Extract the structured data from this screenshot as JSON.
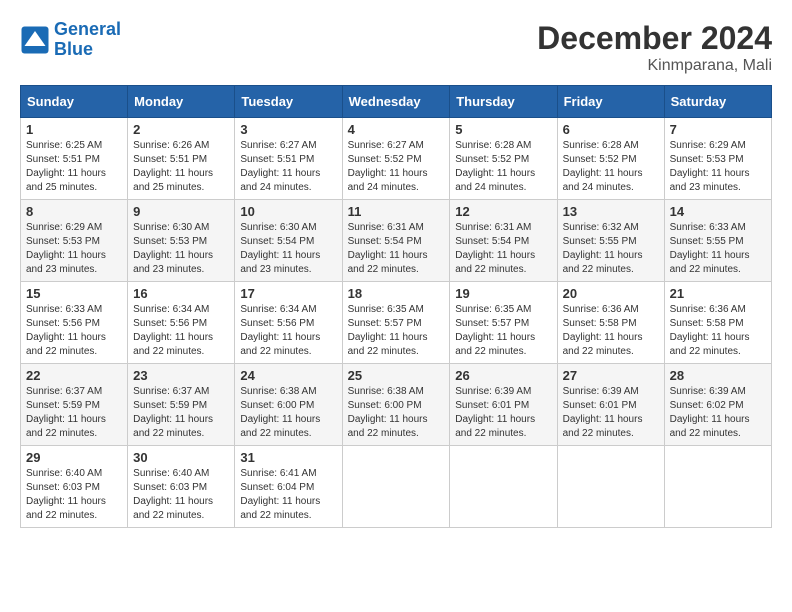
{
  "header": {
    "logo_line1": "General",
    "logo_line2": "Blue",
    "month": "December 2024",
    "location": "Kinmparana, Mali"
  },
  "weekdays": [
    "Sunday",
    "Monday",
    "Tuesday",
    "Wednesday",
    "Thursday",
    "Friday",
    "Saturday"
  ],
  "weeks": [
    [
      {
        "day": "1",
        "info": "Sunrise: 6:25 AM\nSunset: 5:51 PM\nDaylight: 11 hours\nand 25 minutes."
      },
      {
        "day": "2",
        "info": "Sunrise: 6:26 AM\nSunset: 5:51 PM\nDaylight: 11 hours\nand 25 minutes."
      },
      {
        "day": "3",
        "info": "Sunrise: 6:27 AM\nSunset: 5:51 PM\nDaylight: 11 hours\nand 24 minutes."
      },
      {
        "day": "4",
        "info": "Sunrise: 6:27 AM\nSunset: 5:52 PM\nDaylight: 11 hours\nand 24 minutes."
      },
      {
        "day": "5",
        "info": "Sunrise: 6:28 AM\nSunset: 5:52 PM\nDaylight: 11 hours\nand 24 minutes."
      },
      {
        "day": "6",
        "info": "Sunrise: 6:28 AM\nSunset: 5:52 PM\nDaylight: 11 hours\nand 24 minutes."
      },
      {
        "day": "7",
        "info": "Sunrise: 6:29 AM\nSunset: 5:53 PM\nDaylight: 11 hours\nand 23 minutes."
      }
    ],
    [
      {
        "day": "8",
        "info": "Sunrise: 6:29 AM\nSunset: 5:53 PM\nDaylight: 11 hours\nand 23 minutes."
      },
      {
        "day": "9",
        "info": "Sunrise: 6:30 AM\nSunset: 5:53 PM\nDaylight: 11 hours\nand 23 minutes."
      },
      {
        "day": "10",
        "info": "Sunrise: 6:30 AM\nSunset: 5:54 PM\nDaylight: 11 hours\nand 23 minutes."
      },
      {
        "day": "11",
        "info": "Sunrise: 6:31 AM\nSunset: 5:54 PM\nDaylight: 11 hours\nand 22 minutes."
      },
      {
        "day": "12",
        "info": "Sunrise: 6:31 AM\nSunset: 5:54 PM\nDaylight: 11 hours\nand 22 minutes."
      },
      {
        "day": "13",
        "info": "Sunrise: 6:32 AM\nSunset: 5:55 PM\nDaylight: 11 hours\nand 22 minutes."
      },
      {
        "day": "14",
        "info": "Sunrise: 6:33 AM\nSunset: 5:55 PM\nDaylight: 11 hours\nand 22 minutes."
      }
    ],
    [
      {
        "day": "15",
        "info": "Sunrise: 6:33 AM\nSunset: 5:56 PM\nDaylight: 11 hours\nand 22 minutes."
      },
      {
        "day": "16",
        "info": "Sunrise: 6:34 AM\nSunset: 5:56 PM\nDaylight: 11 hours\nand 22 minutes."
      },
      {
        "day": "17",
        "info": "Sunrise: 6:34 AM\nSunset: 5:56 PM\nDaylight: 11 hours\nand 22 minutes."
      },
      {
        "day": "18",
        "info": "Sunrise: 6:35 AM\nSunset: 5:57 PM\nDaylight: 11 hours\nand 22 minutes."
      },
      {
        "day": "19",
        "info": "Sunrise: 6:35 AM\nSunset: 5:57 PM\nDaylight: 11 hours\nand 22 minutes."
      },
      {
        "day": "20",
        "info": "Sunrise: 6:36 AM\nSunset: 5:58 PM\nDaylight: 11 hours\nand 22 minutes."
      },
      {
        "day": "21",
        "info": "Sunrise: 6:36 AM\nSunset: 5:58 PM\nDaylight: 11 hours\nand 22 minutes."
      }
    ],
    [
      {
        "day": "22",
        "info": "Sunrise: 6:37 AM\nSunset: 5:59 PM\nDaylight: 11 hours\nand 22 minutes."
      },
      {
        "day": "23",
        "info": "Sunrise: 6:37 AM\nSunset: 5:59 PM\nDaylight: 11 hours\nand 22 minutes."
      },
      {
        "day": "24",
        "info": "Sunrise: 6:38 AM\nSunset: 6:00 PM\nDaylight: 11 hours\nand 22 minutes."
      },
      {
        "day": "25",
        "info": "Sunrise: 6:38 AM\nSunset: 6:00 PM\nDaylight: 11 hours\nand 22 minutes."
      },
      {
        "day": "26",
        "info": "Sunrise: 6:39 AM\nSunset: 6:01 PM\nDaylight: 11 hours\nand 22 minutes."
      },
      {
        "day": "27",
        "info": "Sunrise: 6:39 AM\nSunset: 6:01 PM\nDaylight: 11 hours\nand 22 minutes."
      },
      {
        "day": "28",
        "info": "Sunrise: 6:39 AM\nSunset: 6:02 PM\nDaylight: 11 hours\nand 22 minutes."
      }
    ],
    [
      {
        "day": "29",
        "info": "Sunrise: 6:40 AM\nSunset: 6:03 PM\nDaylight: 11 hours\nand 22 minutes."
      },
      {
        "day": "30",
        "info": "Sunrise: 6:40 AM\nSunset: 6:03 PM\nDaylight: 11 hours\nand 22 minutes."
      },
      {
        "day": "31",
        "info": "Sunrise: 6:41 AM\nSunset: 6:04 PM\nDaylight: 11 hours\nand 22 minutes."
      },
      {
        "day": "",
        "info": ""
      },
      {
        "day": "",
        "info": ""
      },
      {
        "day": "",
        "info": ""
      },
      {
        "day": "",
        "info": ""
      }
    ]
  ]
}
